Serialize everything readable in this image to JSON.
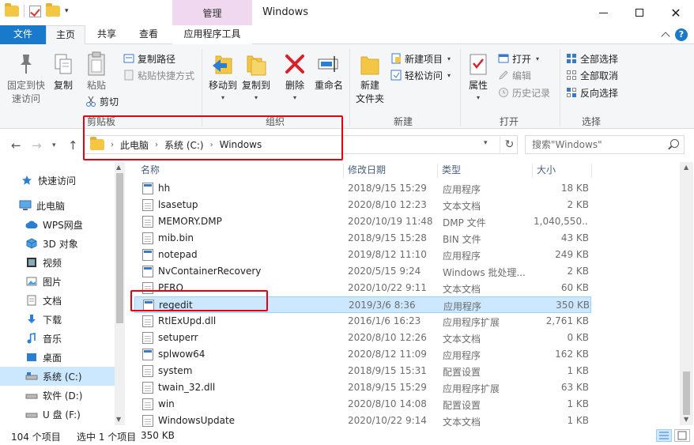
{
  "window": {
    "title": "Windows",
    "context_tab_title": "管理"
  },
  "tabs": {
    "file": "文件",
    "home": "主页",
    "share": "共享",
    "view": "查看",
    "app_tools": "应用程序工具"
  },
  "ribbon": {
    "clipboard": {
      "label": "剪贴板",
      "pin_quick_access": [
        "固定到快",
        "速访问"
      ],
      "copy": "复制",
      "paste": "粘贴",
      "copy_path": "复制路径",
      "paste_shortcut": "粘贴快捷方式",
      "cut": "剪切"
    },
    "organize": {
      "label": "组织",
      "move_to": "移动到",
      "copy_to": "复制到",
      "delete": "删除",
      "rename": "重命名"
    },
    "new": {
      "label": "新建",
      "new_folder": [
        "新建",
        "文件夹"
      ],
      "new_item": "新建项目",
      "easy_access": "轻松访问"
    },
    "open": {
      "label": "打开",
      "properties": "属性",
      "open": "打开",
      "edit": "编辑",
      "history": "历史记录"
    },
    "select": {
      "label": "选择",
      "select_all": "全部选择",
      "select_none": "全部取消",
      "invert": "反向选择"
    }
  },
  "address": {
    "crumbs": [
      "此电脑",
      "系统 (C:)",
      "Windows"
    ],
    "search_placeholder": "搜索\"Windows\""
  },
  "nav": {
    "items": [
      {
        "label": "快速访问",
        "icon": "star-icon"
      },
      {
        "label": "此电脑",
        "icon": "computer-icon"
      },
      {
        "label": "WPS网盘",
        "icon": "cloud-icon"
      },
      {
        "label": "3D 对象",
        "icon": "cube-icon"
      },
      {
        "label": "视频",
        "icon": "video-icon"
      },
      {
        "label": "图片",
        "icon": "picture-icon"
      },
      {
        "label": "文档",
        "icon": "document-icon"
      },
      {
        "label": "下载",
        "icon": "download-icon"
      },
      {
        "label": "音乐",
        "icon": "music-icon"
      },
      {
        "label": "桌面",
        "icon": "desktop-icon"
      },
      {
        "label": "系统 (C:)",
        "icon": "drive-icon"
      },
      {
        "label": "软件 (D:)",
        "icon": "drive-icon"
      },
      {
        "label": "U 盘 (F:)",
        "icon": "usb-drive-icon"
      }
    ]
  },
  "columns": {
    "name": "名称",
    "date": "修改日期",
    "type": "类型",
    "size": "大小"
  },
  "files": [
    {
      "name": "hh",
      "date": "2018/9/15 15:29",
      "type": "应用程序",
      "size": "18 KB",
      "icon": "app"
    },
    {
      "name": "lsasetup",
      "date": "2020/8/10 12:23",
      "type": "文本文档",
      "size": "2 KB",
      "icon": "doc"
    },
    {
      "name": "MEMORY.DMP",
      "date": "2020/10/19 11:48",
      "type": "DMP 文件",
      "size": "1,040,550...",
      "icon": "doc"
    },
    {
      "name": "mib.bin",
      "date": "2018/9/15 15:28",
      "type": "BIN 文件",
      "size": "43 KB",
      "icon": "doc"
    },
    {
      "name": "notepad",
      "date": "2019/8/12 11:10",
      "type": "应用程序",
      "size": "249 KB",
      "icon": "app"
    },
    {
      "name": "NvContainerRecovery",
      "date": "2020/5/15 9:24",
      "type": "Windows 批处理...",
      "size": "2 KB",
      "icon": "app"
    },
    {
      "name": "PFRO",
      "date": "2020/10/22 9:11",
      "type": "文本文档",
      "size": "60 KB",
      "icon": "doc"
    },
    {
      "name": "regedit",
      "date": "2019/3/6 8:36",
      "type": "应用程序",
      "size": "350 KB",
      "icon": "app",
      "selected": true
    },
    {
      "name": "RtlExUpd.dll",
      "date": "2016/1/6 16:23",
      "type": "应用程序扩展",
      "size": "2,761 KB",
      "icon": "doc"
    },
    {
      "name": "setuperr",
      "date": "2020/8/10 12:26",
      "type": "文本文档",
      "size": "0 KB",
      "icon": "doc"
    },
    {
      "name": "splwow64",
      "date": "2020/8/12 11:09",
      "type": "应用程序",
      "size": "162 KB",
      "icon": "app"
    },
    {
      "name": "system",
      "date": "2018/9/15 15:31",
      "type": "配置设置",
      "size": "1 KB",
      "icon": "doc"
    },
    {
      "name": "twain_32.dll",
      "date": "2018/9/15 15:29",
      "type": "应用程序扩展",
      "size": "63 KB",
      "icon": "doc"
    },
    {
      "name": "win",
      "date": "2020/8/10 14:08",
      "type": "配置设置",
      "size": "1 KB",
      "icon": "doc"
    },
    {
      "name": "WindowsUpdate",
      "date": "2020/10/22 9:14",
      "type": "文本文档",
      "size": "1 KB",
      "icon": "doc"
    }
  ],
  "status": {
    "count": "104 个项目",
    "selected": "选中 1 个项目",
    "selected_size": "350 KB"
  },
  "colors": {
    "accent": "#1979ca",
    "selection": "#cce8ff",
    "context_tab": "#f0d8f0",
    "annotation": "#e60012"
  }
}
